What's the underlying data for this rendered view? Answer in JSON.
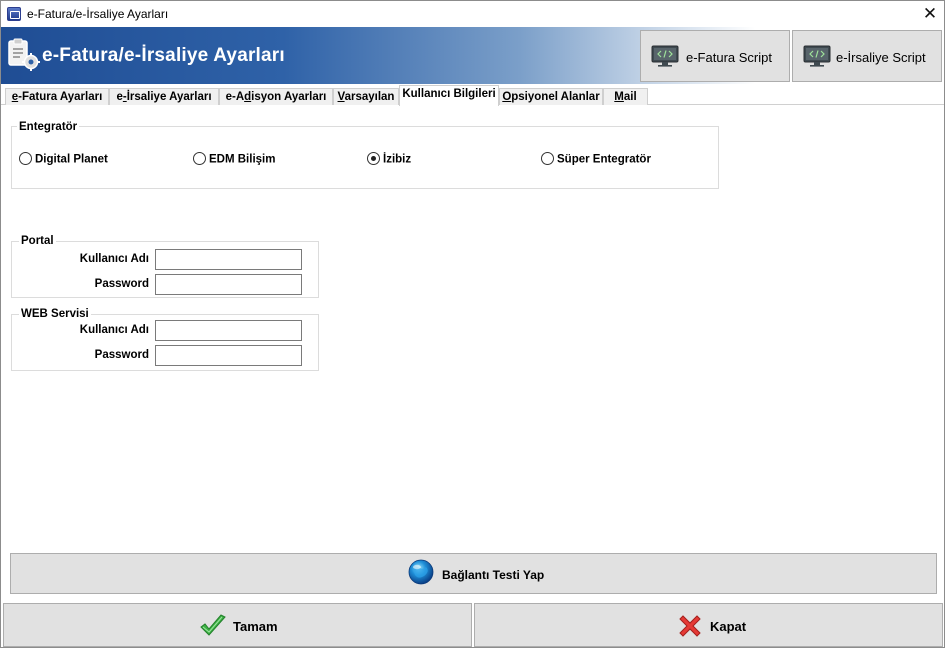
{
  "window": {
    "title": "e-Fatura/e-İrsaliye Ayarları",
    "close_glyph": "✕"
  },
  "banner": {
    "title": "e-Fatura/e-İrsaliye Ayarları",
    "icon": "settings-clipboard-icon"
  },
  "toolbar": {
    "efatura_script_label": "e-Fatura Script",
    "eirsaliye_script_label": "e-İrsaliye Script",
    "script_icon": "monitor-code-icon"
  },
  "tabs": [
    {
      "pre": "",
      "u": "e",
      "post": "-Fatura Ayarları"
    },
    {
      "pre": "e",
      "u": "-",
      "post": "İrsaliye Ayarları"
    },
    {
      "pre": "e-A",
      "u": "d",
      "post": "isyon Ayarları"
    },
    {
      "pre": "",
      "u": "V",
      "post": "arsayılan"
    },
    {
      "pre": "",
      "u": "",
      "post": "Kullanıcı Bilgileri"
    },
    {
      "pre": "",
      "u": "O",
      "post": "psiyonel Alanlar"
    },
    {
      "pre": "",
      "u": "M",
      "post": "ail"
    }
  ],
  "active_tab": 4,
  "entegrator": {
    "label": "Entegratör",
    "options": [
      "Digital Planet",
      "EDM Bilişim",
      "İzibiz",
      "Süper Entegratör"
    ],
    "selected": 2
  },
  "portal": {
    "label": "Portal",
    "username_label": "Kullanıcı Adı",
    "password_label": "Password",
    "username_value": "",
    "password_value": ""
  },
  "web_servisi": {
    "label": "WEB Servisi",
    "username_label": "Kullanıcı Adı",
    "password_label": "Password",
    "username_value": "",
    "password_value": ""
  },
  "actions": {
    "test_label": "Bağlantı Testi Yap",
    "ok_label": "Tamam",
    "close_label": "Kapat"
  },
  "colors": {
    "banner_start": "#1f4d94",
    "ok_check": "#3cb043",
    "close_x": "#e53935"
  }
}
